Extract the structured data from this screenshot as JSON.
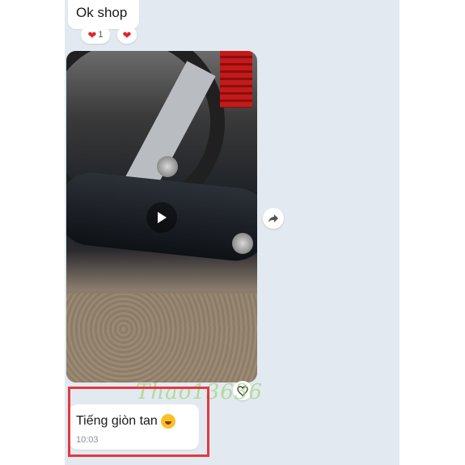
{
  "top_message": {
    "text": "Ok shop",
    "reactions": [
      {
        "icon": "heart-icon",
        "count": "1"
      },
      {
        "icon": "heart-icon",
        "count": ""
      }
    ]
  },
  "video_message": {
    "play_icon": "play-icon",
    "share_icon": "share-icon",
    "like_icon": "heart-outline-icon"
  },
  "watermark": "Thao13636",
  "bottom_message": {
    "text": "Tiếng giòn tan",
    "emoji": "laughing-emoji-icon",
    "time": "10:03"
  },
  "colors": {
    "chat_background": "#e3e9f0",
    "bubble": "#ffffff",
    "highlight": "#e23a3f",
    "heart": "#e0242f"
  }
}
